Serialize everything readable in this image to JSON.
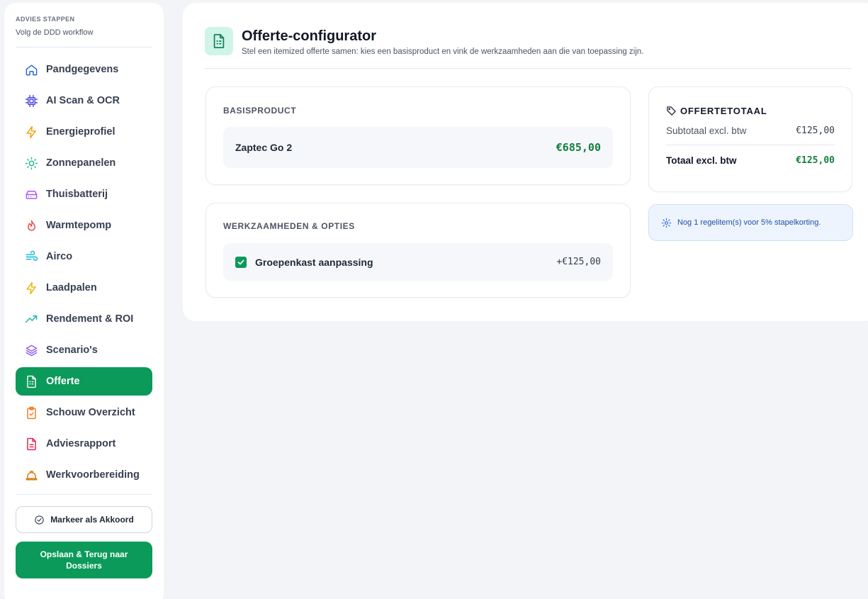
{
  "sidebar": {
    "title": "ADVIES STAPPEN",
    "subtitle": "Volg de DDD workflow",
    "items": [
      {
        "label": "Pandgegevens",
        "icon": "home-icon",
        "color": "#2563eb"
      },
      {
        "label": "AI Scan & OCR",
        "icon": "cpu-icon",
        "color": "#4f46e5"
      },
      {
        "label": "Energieprofiel",
        "icon": "lightning-icon",
        "color": "#f59e0b"
      },
      {
        "label": "Zonnepanelen",
        "icon": "sun-icon",
        "color": "#10b981"
      },
      {
        "label": "Thuisbatterij",
        "icon": "battery-icon",
        "color": "#a855f7"
      },
      {
        "label": "Warmtepomp",
        "icon": "flame-icon",
        "color": "#ef4444"
      },
      {
        "label": "Airco",
        "icon": "wind-icon",
        "color": "#06b6d4"
      },
      {
        "label": "Laadpalen",
        "icon": "lightning-icon",
        "color": "#eab308"
      },
      {
        "label": "Rendement & ROI",
        "icon": "trending-up-icon",
        "color": "#14b8a6"
      },
      {
        "label": "Scenario's",
        "icon": "layers-icon",
        "color": "#8b5cf6"
      },
      {
        "label": "Offerte",
        "icon": "document-icon",
        "color": "#ffffff",
        "active": true
      },
      {
        "label": "Schouw Overzicht",
        "icon": "clipboard-check-icon",
        "color": "#f97316"
      },
      {
        "label": "Adviesrapport",
        "icon": "report-icon",
        "color": "#e11d48"
      },
      {
        "label": "Werkvoorbereiding",
        "icon": "hardhat-icon",
        "color": "#d97706"
      }
    ],
    "approve_button": "Markeer als Akkoord",
    "save_button": "Opslaan & Terug naar Dossiers"
  },
  "header": {
    "title": "Offerte-configurator",
    "subtitle": "Stel een itemized offerte samen: kies een basisproduct en vink de werkzaamheden aan die van toepassing zijn."
  },
  "base_product": {
    "label": "BASISPRODUCT",
    "name": "Zaptec Go 2",
    "price": "€685,00"
  },
  "options": {
    "label": "WERKZAAMHEDEN & OPTIES",
    "items": [
      {
        "name": "Groepenkast aanpassing",
        "price": "+€125,00",
        "checked": true
      }
    ]
  },
  "totals": {
    "label": "OFFERTETOTAAL",
    "subtotal_label": "Subtotaal excl. btw",
    "subtotal_value": "€125,00",
    "total_label": "Totaal excl. btw",
    "total_value": "€125,00"
  },
  "info": {
    "text": "Nog 1 regelitem(s) voor 5% stapelkorting."
  },
  "colors": {
    "accent": "#0b9a5a",
    "price_green": "#15803d"
  }
}
